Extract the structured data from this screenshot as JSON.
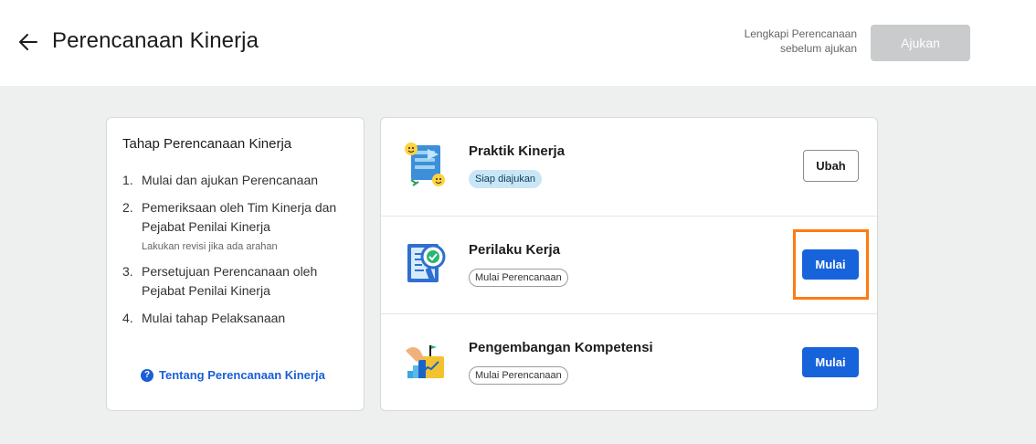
{
  "header": {
    "title": "Perencanaan Kinerja",
    "submit_hint": "Lengkapi Perencanaan sebelum ajukan",
    "submit_label": "Ajukan",
    "back_icon": "arrow-left-icon"
  },
  "steps": {
    "title": "Tahap Perencanaan Kinerja",
    "items": [
      {
        "num": "1.",
        "text": "Mulai dan ajukan Perencanaan",
        "sub": ""
      },
      {
        "num": "2.",
        "text": "Pemeriksaan oleh Tim Kinerja dan Pejabat Penilai Kinerja",
        "sub": "Lakukan revisi jika ada arahan"
      },
      {
        "num": "3.",
        "text": "Persetujuan Perencanaan oleh Pejabat Penilai Kinerja",
        "sub": ""
      },
      {
        "num": "4.",
        "text": "Mulai tahap Pelaksanaan",
        "sub": ""
      }
    ],
    "help_link": "Tentang Perencanaan Kinerja",
    "help_icon_glyph": "?"
  },
  "tasks": [
    {
      "title": "Praktik Kinerja",
      "badge": "Siap diajukan",
      "button": "Ubah",
      "icon": "performance-practice-icon"
    },
    {
      "title": "Perilaku Kerja",
      "badge": "Mulai Perencanaan",
      "button": "Mulai",
      "icon": "work-behavior-icon"
    },
    {
      "title": "Pengembangan Kompetensi",
      "badge": "Mulai Perencanaan",
      "button": "Mulai",
      "icon": "competency-development-icon"
    }
  ],
  "colors": {
    "primary": "#1763db",
    "highlight": "#ff7b12",
    "disabled": "#c9cbcc",
    "link": "#1a5fd6"
  }
}
